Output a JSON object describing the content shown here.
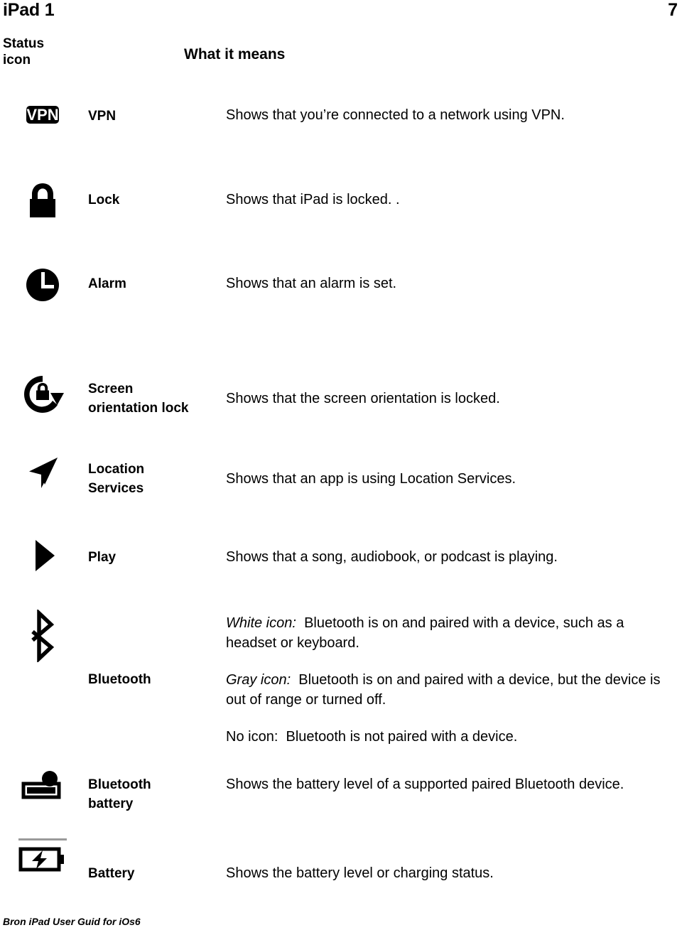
{
  "header": {
    "doc_title": "iPad 1",
    "page_number": "7"
  },
  "columns": {
    "icon_header": "Status\nicon",
    "icon_header_line1": "Status",
    "icon_header_line2": "icon",
    "means_header": "What it means"
  },
  "rows": [
    {
      "icon": "vpn-icon",
      "icon_label": "VPN",
      "name": "VPN",
      "paragraphs": [
        {
          "lead": "",
          "text": "Shows that you’re connected to a network using VPN."
        }
      ]
    },
    {
      "icon": "lock-icon",
      "name": "Lock",
      "paragraphs": [
        {
          "lead": "",
          "text": "Shows that iPad is locked. ."
        }
      ]
    },
    {
      "icon": "alarm-clock-icon",
      "name": "Alarm",
      "paragraphs": [
        {
          "lead": "",
          "text": "Shows that an alarm is set."
        }
      ]
    },
    {
      "icon": "screen-orientation-lock-icon",
      "name": "Screen\norientation lock",
      "name_line1": "Screen",
      "name_line2": "orientation lock",
      "paragraphs": [
        {
          "lead": "",
          "text": "Shows that the screen orientation is locked."
        }
      ]
    },
    {
      "icon": "location-services-icon",
      "name": "Location\nServices",
      "name_line1": "Location",
      "name_line2": "Services",
      "paragraphs": [
        {
          "lead": "",
          "text": "Shows that an app is using Location Services."
        }
      ]
    },
    {
      "icon": "play-icon",
      "name": "Play",
      "paragraphs": [
        {
          "lead": "",
          "text": "Shows that a song, audiobook, or podcast is playing."
        }
      ]
    },
    {
      "icon": "bluetooth-icon",
      "name": "Bluetooth",
      "paragraphs": [
        {
          "lead": "White icon:",
          "text": "Bluetooth is on and paired with a device, such as a headset or keyboard."
        },
        {
          "lead": "Gray icon:",
          "text": "Bluetooth is on and paired with a device, but the device is out of range or turned off."
        },
        {
          "lead": "No icon:",
          "text": "Bluetooth is not paired with a device."
        }
      ]
    },
    {
      "icon": "bluetooth-battery-icon",
      "name": "Bluetooth\nbattery",
      "name_line1": "Bluetooth",
      "name_line2": "battery",
      "paragraphs": [
        {
          "lead": "",
          "text": "Shows the battery level of a supported paired Bluetooth device."
        }
      ]
    },
    {
      "icon": "battery-charging-icon",
      "name": "Battery",
      "paragraphs": [
        {
          "lead": "",
          "text": "Shows the battery level or charging status."
        }
      ]
    }
  ],
  "bluetooth_row": {
    "white_icon_lead": "White icon:",
    "white_icon_text": "Bluetooth is on and paired with a device, such as a headset or keyboard.",
    "gray_icon_lead": "Gray icon:",
    "gray_icon_text": "Bluetooth is on and paired with a device, but the device is out of range or turned off.",
    "no_icon_lead": "No icon:",
    "no_icon_text": "Bluetooth is not paired with a device."
  },
  "footer": {
    "note": "Bron iPad User Guid for iOs6"
  },
  "colors": {
    "ink": "#000000",
    "paper": "#ffffff",
    "rule_gray": "#9a9a9a"
  }
}
